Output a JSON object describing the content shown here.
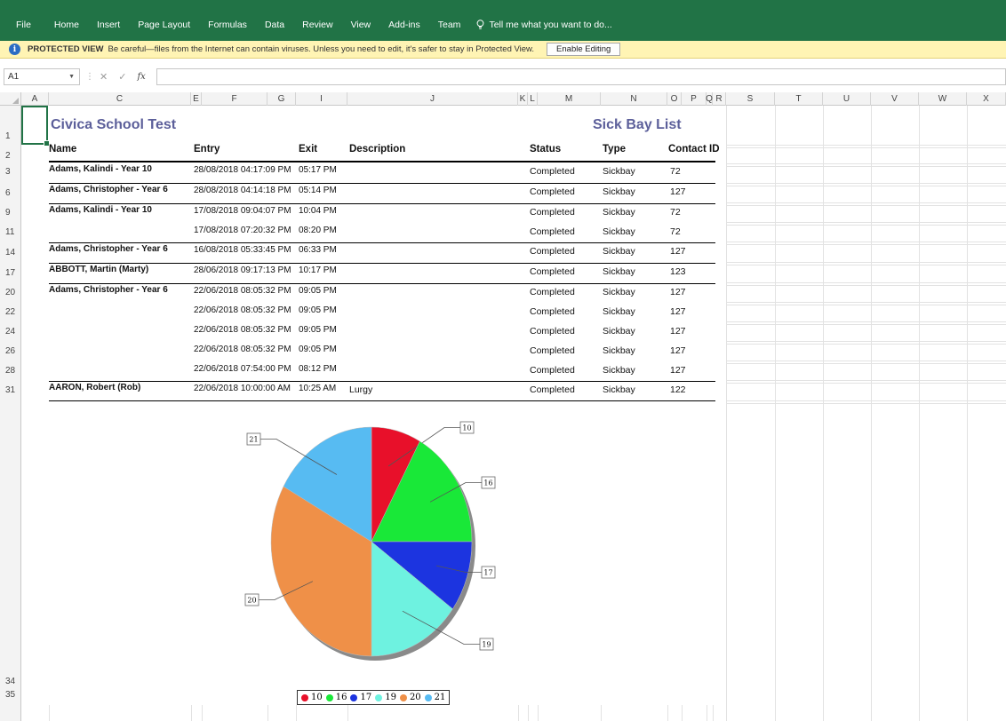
{
  "ribbon": {
    "tabs": [
      "File",
      "Home",
      "Insert",
      "Page Layout",
      "Formulas",
      "Data",
      "Review",
      "View",
      "Add-ins",
      "Team"
    ],
    "tell_me": "Tell me what you want to do...",
    "color": "#217346"
  },
  "protected_view": {
    "label": "PROTECTED VIEW",
    "message": "Be careful—files from the Internet can contain viruses. Unless you need to edit, it's safer to stay in Protected View.",
    "button": "Enable Editing"
  },
  "formula_bar": {
    "name_box": "A1",
    "fx_label": "fx",
    "cancel_icon": "close-icon",
    "enter_icon": "check-icon"
  },
  "columns": [
    "A",
    "C",
    "E",
    "F",
    "G",
    "I",
    "J",
    "K",
    "L",
    "M",
    "N",
    "O",
    "P",
    "Q",
    "R",
    "S",
    "T",
    "U",
    "V",
    "W",
    "X"
  ],
  "row_numbers": [
    "1",
    "2",
    "3",
    "6",
    "9",
    "11",
    "14",
    "17",
    "20",
    "22",
    "24",
    "26",
    "28",
    "31",
    "34",
    "35"
  ],
  "report": {
    "school": "Civica School Test",
    "list_title": "Sick Bay List",
    "title_color": "#5c5f9a",
    "headers": {
      "name": "Name",
      "entry": "Entry",
      "exit": "Exit",
      "description": "Description",
      "status": "Status",
      "type": "Type",
      "contact": "Contact ID"
    },
    "rows": [
      {
        "name": "Adams, Kalindi - Year 10",
        "entry": "28/08/2018 04:17:09 PM",
        "exit": "05:17 PM",
        "description": "",
        "status": "Completed",
        "type": "Sickbay",
        "contact": "72"
      },
      {
        "name": "Adams, Christopher - Year 6",
        "entry": "28/08/2018 04:14:18 PM",
        "exit": "05:14 PM",
        "description": "",
        "status": "Completed",
        "type": "Sickbay",
        "contact": "127"
      },
      {
        "name": "Adams, Kalindi - Year 10",
        "entry": "17/08/2018 09:04:07 PM",
        "exit": "10:04 PM",
        "description": "",
        "status": "Completed",
        "type": "Sickbay",
        "contact": "72"
      },
      {
        "name": "",
        "entry": "17/08/2018 07:20:32 PM",
        "exit": "08:20 PM",
        "description": "",
        "status": "Completed",
        "type": "Sickbay",
        "contact": "72"
      },
      {
        "name": "Adams, Christopher - Year 6",
        "entry": "16/08/2018 05:33:45 PM",
        "exit": "06:33 PM",
        "description": "",
        "status": "Completed",
        "type": "Sickbay",
        "contact": "127"
      },
      {
        "name": "ABBOTT, Martin (Marty)",
        "entry": "28/06/2018 09:17:13 PM",
        "exit": "10:17 PM",
        "description": "",
        "status": "Completed",
        "type": "Sickbay",
        "contact": "123"
      },
      {
        "name": "Adams, Christopher - Year 6",
        "entry": "22/06/2018 08:05:32 PM",
        "exit": "09:05 PM",
        "description": "",
        "status": "Completed",
        "type": "Sickbay",
        "contact": "127"
      },
      {
        "name": "",
        "entry": "22/06/2018 08:05:32 PM",
        "exit": "09:05 PM",
        "description": "",
        "status": "Completed",
        "type": "Sickbay",
        "contact": "127"
      },
      {
        "name": "",
        "entry": "22/06/2018 08:05:32 PM",
        "exit": "09:05 PM",
        "description": "",
        "status": "Completed",
        "type": "Sickbay",
        "contact": "127"
      },
      {
        "name": "",
        "entry": "22/06/2018 08:05:32 PM",
        "exit": "09:05 PM",
        "description": "",
        "status": "Completed",
        "type": "Sickbay",
        "contact": "127"
      },
      {
        "name": "",
        "entry": "22/06/2018 07:54:00 PM",
        "exit": "08:12 PM",
        "description": "",
        "status": "Completed",
        "type": "Sickbay",
        "contact": "127"
      },
      {
        "name": "AARON, Robert (Rob)",
        "entry": "22/06/2018 10:00:00 AM",
        "exit": "10:25 AM",
        "description": "Lurgy",
        "status": "Completed",
        "type": "Sickbay",
        "contact": "122"
      }
    ]
  },
  "chart_data": {
    "type": "pie",
    "categories": [
      "10",
      "16",
      "17",
      "19",
      "20",
      "21"
    ],
    "values": [
      8,
      17,
      10,
      15,
      33,
      17
    ],
    "colors": [
      "#e8102a",
      "#19e838",
      "#1c34e0",
      "#6ef2e0",
      "#ef9048",
      "#57bbf2"
    ],
    "legend": [
      "10",
      "16",
      "17",
      "19",
      "20",
      "21"
    ],
    "legend_position": "bottom"
  }
}
